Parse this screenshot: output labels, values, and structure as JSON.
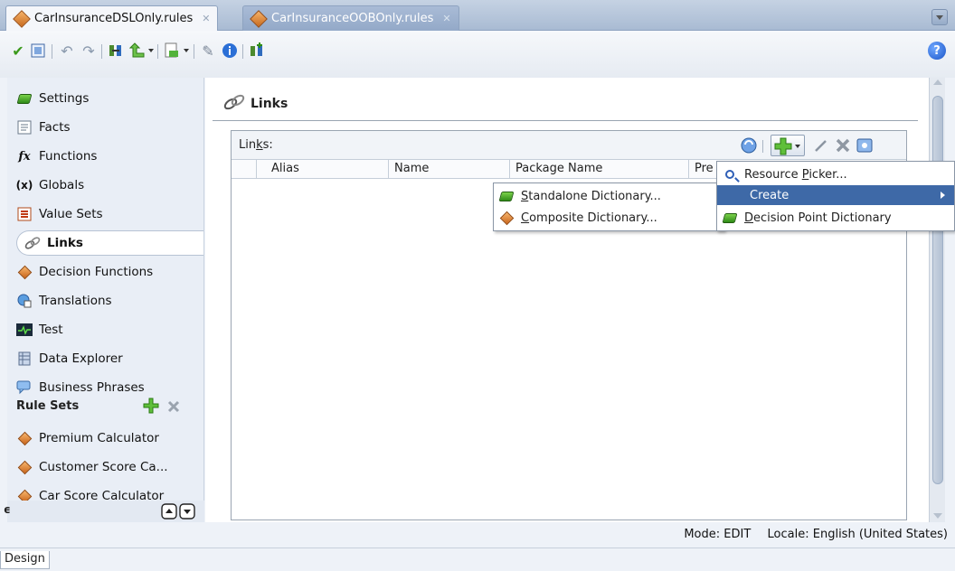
{
  "tabs": [
    {
      "label": "CarInsuranceDSLOnly.rules",
      "active": true
    },
    {
      "label": "CarInsuranceOOBOnly.rules",
      "active": false
    }
  ],
  "toolbar": {
    "icons": [
      "check-icon",
      "validate-icon",
      "undo-icon",
      "redo-icon",
      "link-icon",
      "up-arrow-icon",
      "generate-icon",
      "wrench-icon",
      "info-icon",
      "link-plus-icon"
    ],
    "help_label": "?"
  },
  "nav": {
    "items": [
      {
        "label": "Settings",
        "icon": "settings-icon"
      },
      {
        "label": "Facts",
        "icon": "facts-icon"
      },
      {
        "label": "Functions",
        "icon": "functions-icon",
        "glyph": "fx"
      },
      {
        "label": "Globals",
        "icon": "globals-icon",
        "glyph": "(x)"
      },
      {
        "label": "Value Sets",
        "icon": "value-sets-icon"
      },
      {
        "label": "Links",
        "icon": "links-icon",
        "selected": true
      },
      {
        "label": "Decision Functions",
        "icon": "decision-functions-icon"
      },
      {
        "label": "Translations",
        "icon": "translations-icon"
      },
      {
        "label": "Test",
        "icon": "test-icon"
      },
      {
        "label": "Data Explorer",
        "icon": "data-explorer-icon"
      },
      {
        "label": "Business Phrases",
        "icon": "business-phrases-icon"
      }
    ],
    "rulesets_header": "Rule Sets",
    "rulesets": [
      {
        "label": "Premium Calculator"
      },
      {
        "label": "Customer Score Ca..."
      },
      {
        "label": "Car Score Calculator"
      }
    ],
    "footer_left": "ϵ"
  },
  "main": {
    "title": "Links",
    "panel_label_pre": "Lin",
    "panel_label_mn": "k",
    "panel_label_post": "s:",
    "columns": [
      "Alias",
      "Name",
      "Package Name",
      "Pre"
    ]
  },
  "add_menu": {
    "items": [
      {
        "pre": "Resource ",
        "mn": "P",
        "post": "icker...",
        "icon": "search-icon"
      },
      {
        "label": "Create",
        "highlighted": true,
        "submenu": true
      },
      {
        "pre": "",
        "mn": "D",
        "post": "ecision Point Dictionary",
        "icon": "dictionary-icon"
      }
    ]
  },
  "create_submenu": {
    "items": [
      {
        "pre": "",
        "mn": "S",
        "post": "tandalone Dictionary...",
        "icon": "standalone-dictionary-icon"
      },
      {
        "pre": "",
        "mn": "C",
        "post": "omposite Dictionary...",
        "icon": "composite-dictionary-icon"
      }
    ]
  },
  "status": {
    "mode": "Mode: EDIT",
    "locale": "Locale: English (United States)"
  },
  "bottom": {
    "design_tab": "Design"
  }
}
